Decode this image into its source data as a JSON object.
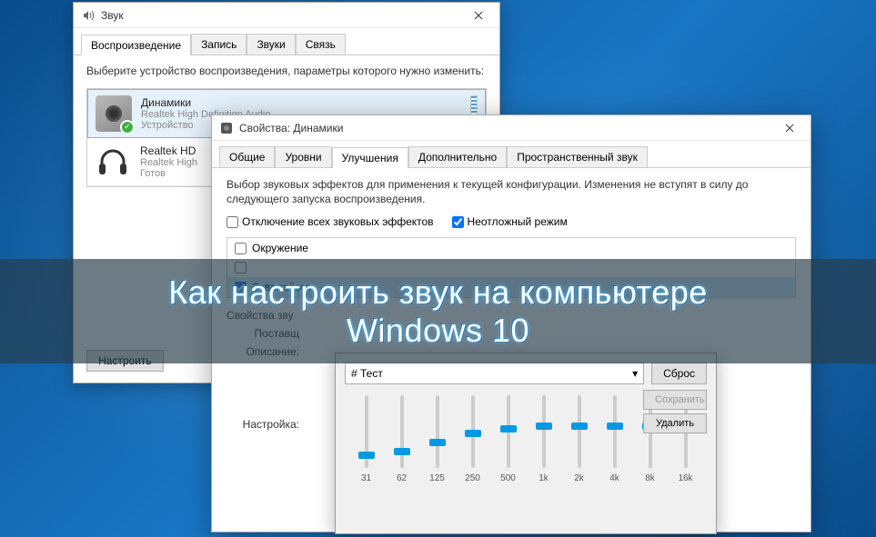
{
  "win1": {
    "title": "Звук",
    "tabs": [
      "Воспроизведение",
      "Запись",
      "Звуки",
      "Связь"
    ],
    "active_tab": 0,
    "instruction": "Выберите устройство воспроизведения, параметры которого нужно изменить:",
    "devices": [
      {
        "name": "Динамики",
        "sub1": "Realtek High Definition Audio",
        "sub2": "Устройство",
        "default": true
      },
      {
        "name": "Realtek HD",
        "sub1": "Realtek High",
        "sub2": "Готов",
        "default": false
      }
    ],
    "configure_btn": "Настроить"
  },
  "win2": {
    "title": "Свойства: Динамики",
    "tabs": [
      "Общие",
      "Уровни",
      "Улучшения",
      "Дополнительно",
      "Пространственный звук"
    ],
    "active_tab": 2,
    "desc": "Выбор звуковых эффектов для применения к текущей конфигурации. Изменения не вступят в силу до следующего запуска воспроизведения.",
    "disable_all": "Отключение всех звуковых эффектов",
    "urgent_mode": "Неотложный режим",
    "effects": [
      {
        "label": "Окружение",
        "checked": false
      },
      {
        "label": "",
        "checked": false
      },
      {
        "label": "Эквалайзер",
        "checked": true
      }
    ],
    "effect_props_title": "Свойства зву",
    "supplier_label": "Поставщ",
    "desc_label": "Описание:",
    "settings_label": "Настройка:"
  },
  "eq": {
    "preset": "# Тест",
    "reset_btn": "Сброс",
    "save_btn": "Сохранить",
    "delete_btn": "Удалить",
    "bands": [
      {
        "freq": "31",
        "pos": 62
      },
      {
        "freq": "62",
        "pos": 58
      },
      {
        "freq": "125",
        "pos": 48
      },
      {
        "freq": "250",
        "pos": 38
      },
      {
        "freq": "500",
        "pos": 33
      },
      {
        "freq": "1k",
        "pos": 30
      },
      {
        "freq": "2k",
        "pos": 30
      },
      {
        "freq": "4k",
        "pos": 30
      },
      {
        "freq": "8k",
        "pos": 30
      },
      {
        "freq": "16k",
        "pos": 28
      }
    ]
  },
  "overlay": {
    "line1": "Как настроить звук на компьютере",
    "line2": "Windows 10"
  }
}
